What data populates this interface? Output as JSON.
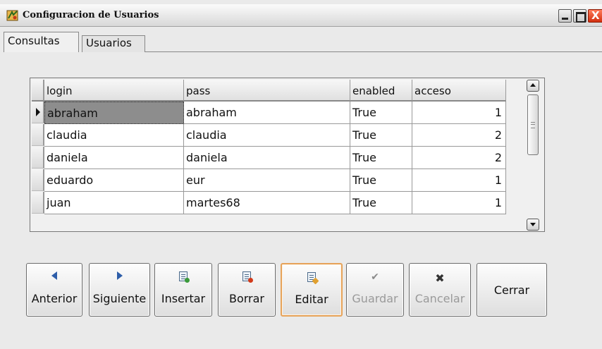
{
  "window": {
    "title": "Configuracion de Usuarios",
    "close_glyph": "X"
  },
  "tabs": [
    {
      "label": "Consultas",
      "active": true
    },
    {
      "label": "Usuarios",
      "active": false
    }
  ],
  "grid": {
    "columns": [
      "login",
      "pass",
      "enabled",
      "acceso"
    ],
    "rows": [
      {
        "login": "abraham",
        "pass": "abraham",
        "enabled": "True",
        "acceso": "1"
      },
      {
        "login": "claudia",
        "pass": "claudia",
        "enabled": "True",
        "acceso": "2"
      },
      {
        "login": "daniela",
        "pass": "daniela",
        "enabled": "True",
        "acceso": "2"
      },
      {
        "login": "eduardo",
        "pass": "eur",
        "enabled": "True",
        "acceso": "1"
      },
      {
        "login": "juan",
        "pass": "martes68",
        "enabled": "True",
        "acceso": "1"
      }
    ]
  },
  "buttons": {
    "anterior": {
      "label": "Anterior",
      "icon": "arrow-left-icon"
    },
    "siguiente": {
      "label": "Siguiente",
      "icon": "arrow-right-icon"
    },
    "insertar": {
      "label": "Insertar",
      "icon": "insert-record-icon"
    },
    "borrar": {
      "label": "Borrar",
      "icon": "delete-record-icon"
    },
    "editar": {
      "label": "Editar",
      "icon": "edit-record-icon"
    },
    "guardar": {
      "label": "Guardar",
      "icon": "checkmark-icon",
      "icon_glyph": "✔"
    },
    "cancelar": {
      "label": "Cancelar",
      "icon": "cancel-x-icon",
      "icon_glyph": "✖"
    },
    "cerrar": {
      "label": "Cerrar"
    }
  },
  "colors": {
    "selected_cell": "#8d8d8d",
    "focus_border": "#e6a35a",
    "icon_blue": "#2e5ea9"
  }
}
